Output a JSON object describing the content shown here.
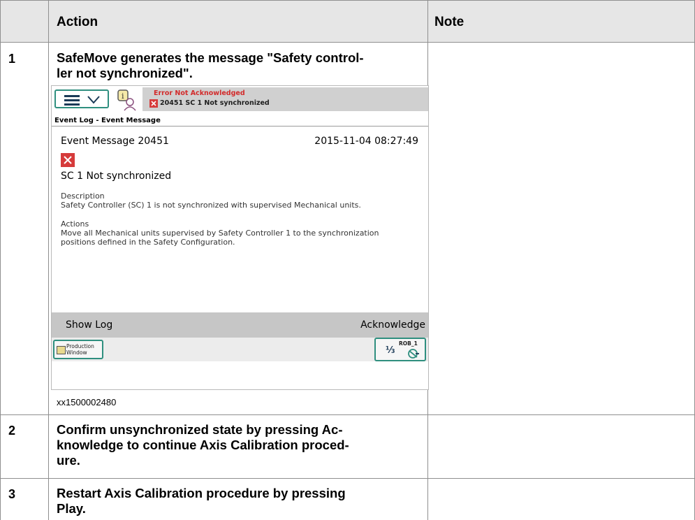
{
  "table": {
    "headers": {
      "action": "Action",
      "note": "Note"
    },
    "rows": [
      {
        "num": "1",
        "action_line1": "SafeMove generates the message \"Safety control-",
        "action_line2": "ler not synchronized\".",
        "caption": "xx1500002480"
      },
      {
        "num": "2",
        "line1_pre": "Confirm unsynchronized state by pressing ",
        "line1_bold": "Ac-",
        "line2_bold": "knowledge",
        "line2_post": " to continue Axis Calibration proced-",
        "line3": "ure."
      },
      {
        "num": "3",
        "line1": "Restart Axis Calibration procedure by pressing",
        "line2_bold": "Play",
        "line2_post": "."
      }
    ]
  },
  "screenshot": {
    "banner_title": "Error Not Acknowledged",
    "banner_message": "20451  SC 1 Not synchronized",
    "breadcrumb": "Event Log - Event Message",
    "event_title": "Event Message 20451",
    "event_datetime": "2015-11-04 08:27:49",
    "event_heading": "SC 1 Not synchronized",
    "description_label": "Description",
    "description_text": "Safety Controller (SC) 1 is not synchronized with supervised Mechanical units.",
    "actions_label": "Actions",
    "actions_line1": "Move all Mechanical units supervised by Safety Controller 1 to the synchronization",
    "actions_line2": "positions defined in the Safety Configuration.",
    "show_log_label": "Show Log",
    "acknowledge_label": "Acknowledge",
    "production_line1": "Production",
    "production_line2": "Window",
    "robot_label": "ROB_1",
    "robot_fraction": "⅓",
    "colors": {
      "error_red": "#d63b3b",
      "accent_teal": "#2f8f7f",
      "banner_grey": "#d0d0d0",
      "header_grey": "#e6e6e6"
    }
  },
  "icons": [
    "menu-icon",
    "chevron-down-icon",
    "status-info-icon",
    "error-icon",
    "production-window-icon",
    "robot-speed-icon"
  ]
}
